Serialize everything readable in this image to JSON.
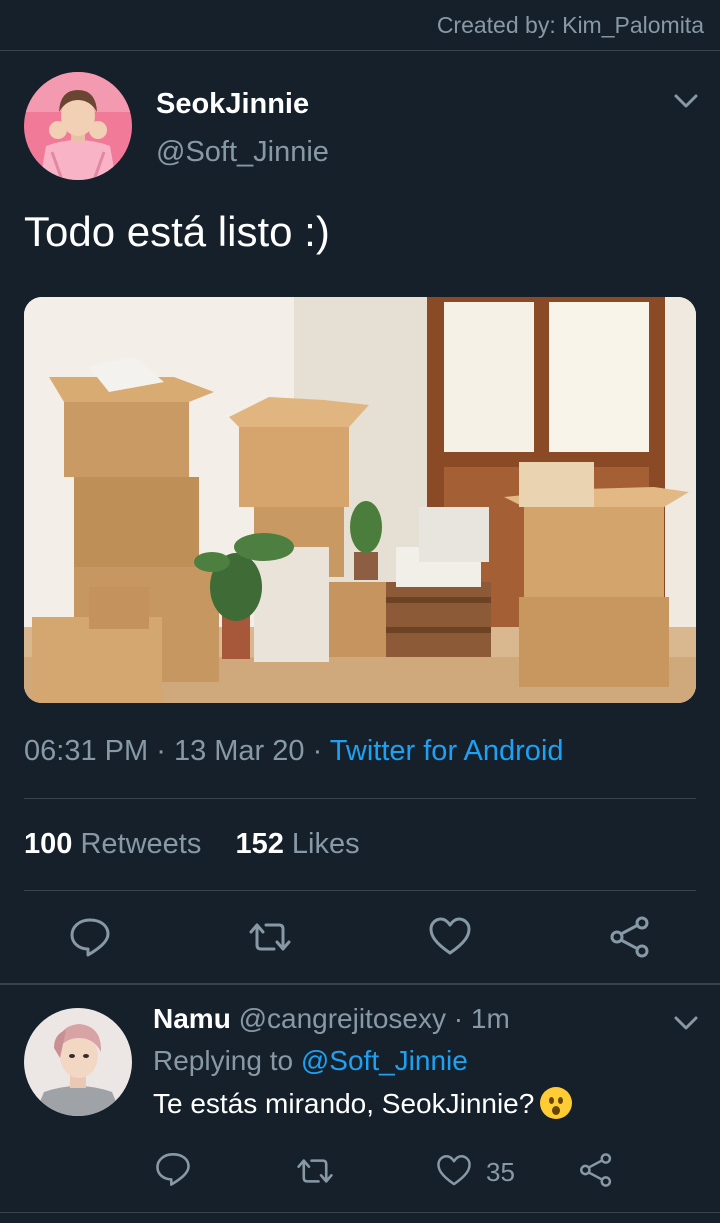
{
  "header": {
    "credit": "Created by: Kim_Palomita"
  },
  "tweet": {
    "author_name": "SeokJinnie",
    "author_handle": "@Soft_Jinnie",
    "text": "Todo está listo :)",
    "time": "06:31 PM",
    "date": "13 Mar 20",
    "source": "Twitter for Android",
    "retweets_count": "100",
    "retweets_label": "Retweets",
    "likes_count": "152",
    "likes_label": "Likes"
  },
  "reply": {
    "author_name": "Namu",
    "author_handle": "@cangrejitosexy",
    "time": "1m",
    "replying_label": "Replying to",
    "replying_to": "@Soft_Jinnie",
    "text": "Te estás mirando, SeokJinnie?",
    "likes_count": "35"
  },
  "icons": [
    "chevron-down-icon",
    "reply-icon",
    "retweet-icon",
    "like-icon",
    "share-icon",
    "surprised-emoji-icon"
  ],
  "colors": {
    "background": "#15202b",
    "accent": "#1da1f2",
    "secondary_text": "#8899a6",
    "divider": "#38444d"
  }
}
